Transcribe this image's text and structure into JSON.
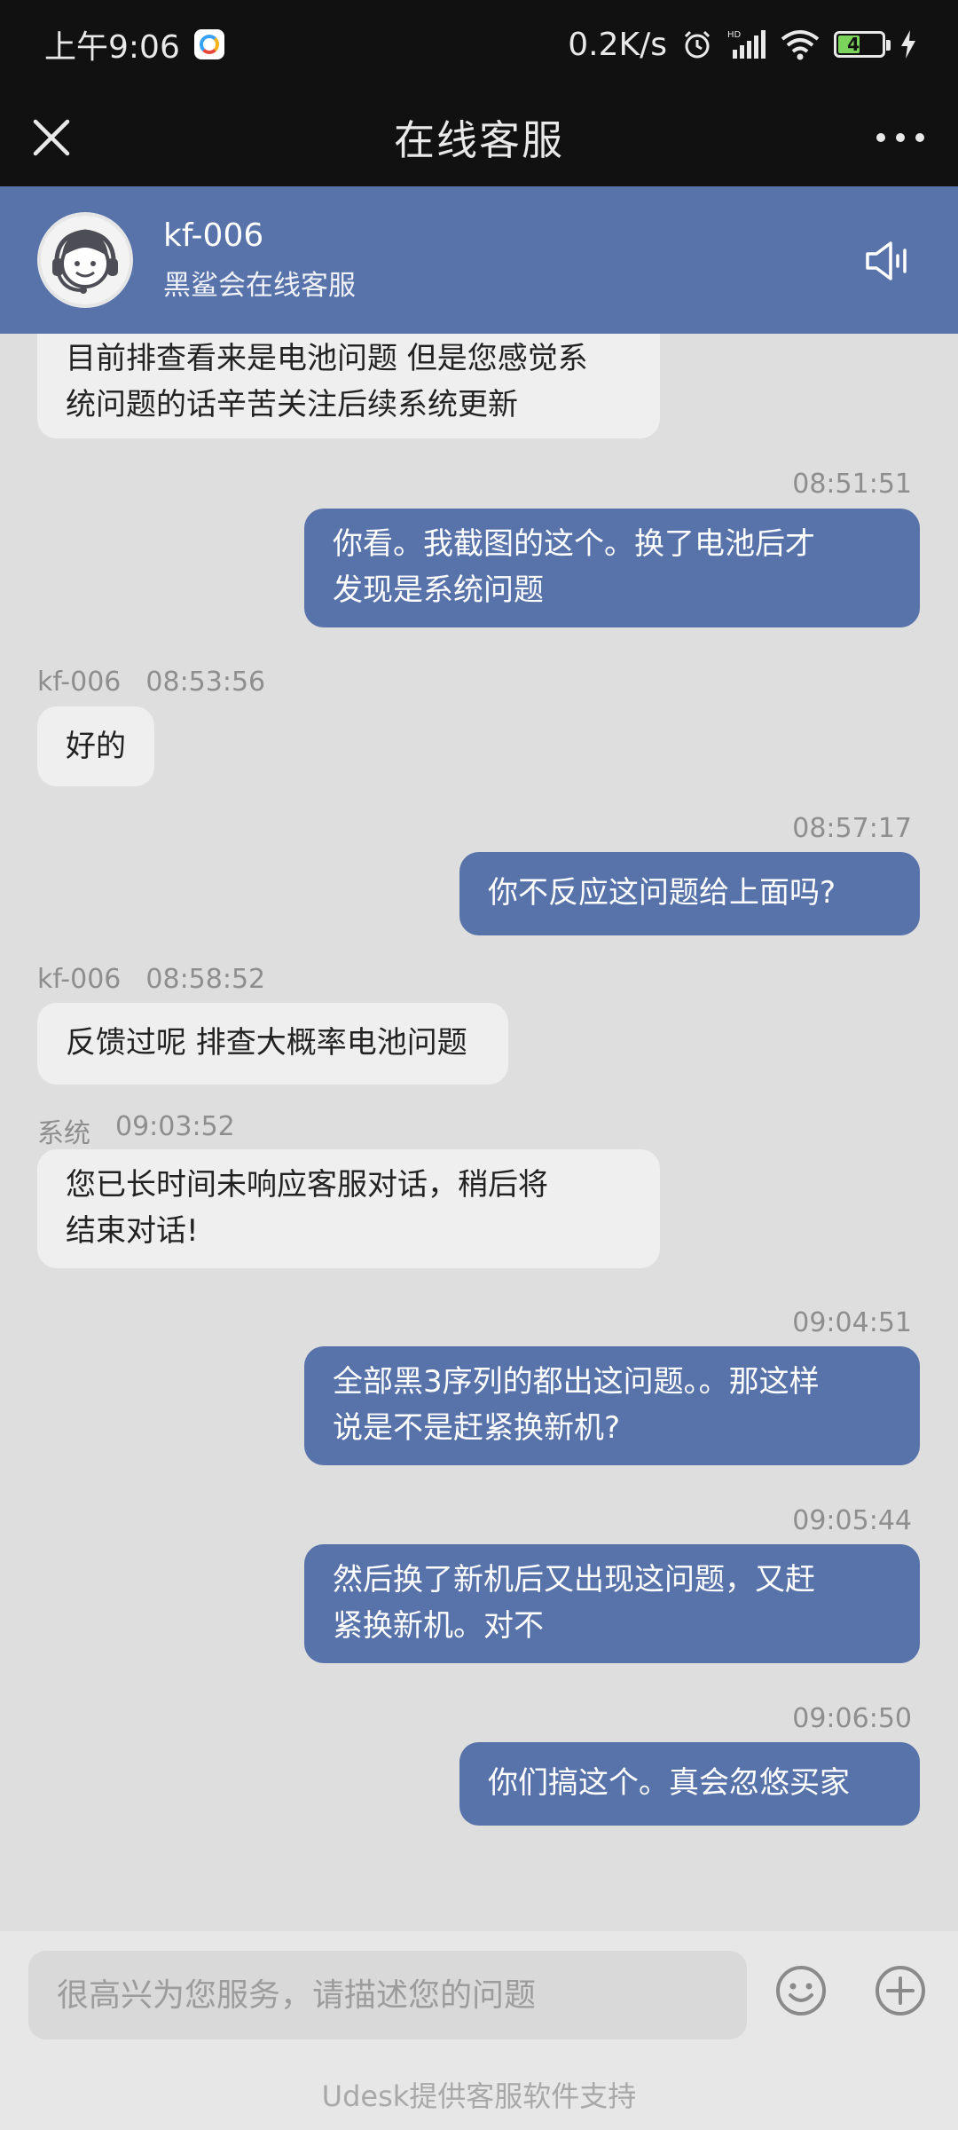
{
  "status_bar": {
    "time": "上午9:06",
    "network_speed": "0.2K/s",
    "battery": "48"
  },
  "title_bar": {
    "title": "在线客服"
  },
  "agent": {
    "name": "kf-006",
    "subtitle": "黑鲨会在线客服"
  },
  "messages": [
    {
      "from": "agent",
      "text_lines": [
        "目前排查看来是电池问题 但是您感觉系",
        "统问题的话辛苦关注后续系统更新"
      ]
    },
    {
      "from": "user",
      "time": "08:51:51",
      "text_lines": [
        "你看。我截图的这个。换了电池后才",
        "发现是系统问题"
      ]
    },
    {
      "from": "agent",
      "sender": "kf-006",
      "time": "08:53:56",
      "text_lines": [
        "好的"
      ]
    },
    {
      "from": "user",
      "time": "08:57:17",
      "text_lines": [
        "你不反应这问题给上面吗?"
      ]
    },
    {
      "from": "agent",
      "sender": "kf-006",
      "time": "08:58:52",
      "text_lines": [
        "反馈过呢 排查大概率电池问题"
      ]
    },
    {
      "from": "system",
      "sender": "系统",
      "time": "09:03:52",
      "text_lines": [
        "您已长时间未响应客服对话，稍后将",
        "结束对话!"
      ]
    },
    {
      "from": "user",
      "time": "09:04:51",
      "text_lines": [
        "全部黑3序列的都出这问题。。那这样",
        "说是不是赶紧换新机?"
      ]
    },
    {
      "from": "user",
      "time": "09:05:44",
      "text_lines": [
        "然后换了新机后又出现这问题，又赶",
        "紧换新机。对不"
      ]
    },
    {
      "from": "user",
      "time": "09:06:50",
      "text_lines": [
        "你们搞这个。真会忽悠买家"
      ]
    }
  ],
  "composer": {
    "placeholder": "很高兴为您服务，请描述您的问题"
  },
  "footer": {
    "text": "Udesk提供客服软件支持"
  },
  "colors": {
    "header_bg": "#5872aa",
    "user_bubble": "#5872aa",
    "agent_bubble": "#efefef",
    "chat_bg": "#dedede",
    "top_bar": "#111111"
  }
}
